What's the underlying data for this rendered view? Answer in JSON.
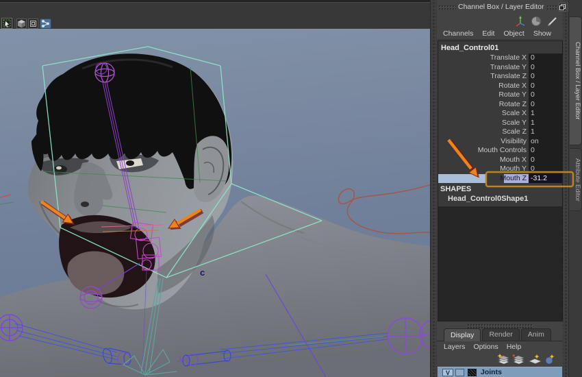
{
  "viewport": {
    "toolbar_icons": [
      "select-tool",
      "polygon-cube",
      "component-box",
      "share-node"
    ],
    "annotation_letter": "c"
  },
  "channel_box": {
    "title": "Channel Box / Layer Editor",
    "menus": [
      "Channels",
      "Edit",
      "Object",
      "Show"
    ],
    "object_name": "Head_Control01",
    "channels": [
      {
        "name": "Translate X",
        "value": "0"
      },
      {
        "name": "Translate Y",
        "value": "0"
      },
      {
        "name": "Translate Z",
        "value": "0"
      },
      {
        "name": "Rotate X",
        "value": "0"
      },
      {
        "name": "Rotate Y",
        "value": "0"
      },
      {
        "name": "Rotate Z",
        "value": "0"
      },
      {
        "name": "Scale X",
        "value": "1"
      },
      {
        "name": "Scale Y",
        "value": "1"
      },
      {
        "name": "Scale Z",
        "value": "1"
      },
      {
        "name": "Visibility",
        "value": "on"
      },
      {
        "name": "Mouth Controls",
        "value": "0"
      },
      {
        "name": "Mouth X",
        "value": "0"
      },
      {
        "name": "Mouth Y",
        "value": "0"
      },
      {
        "name": "Mouth Z",
        "value": "-31.2",
        "highlighted": true
      }
    ],
    "shapes_header": "SHAPES",
    "shape_name": "Head_Control0Shape1"
  },
  "layer_editor": {
    "tabs": [
      {
        "label": "Display",
        "active": true
      },
      {
        "label": "Render",
        "active": false
      },
      {
        "label": "Anim",
        "active": false
      }
    ],
    "menus": [
      "Layers",
      "Options",
      "Help"
    ],
    "layer": {
      "visibility": "V",
      "name": "Joints"
    }
  },
  "side_tabs": [
    {
      "label": "Channel Box / Layer Editor",
      "active": true
    },
    {
      "label": "Attribute Editor",
      "active": false
    }
  ],
  "colors": {
    "highlight_row": "#a9bdd9",
    "selected_label_bg": "#a9aeda",
    "annotation_arrow": "#ea841e",
    "annotation_box": "#bd831e",
    "viewport_bg_top": "#8292a6",
    "control_wireframe": "#8ce4c8",
    "rig_curve": "#b24ed2"
  }
}
